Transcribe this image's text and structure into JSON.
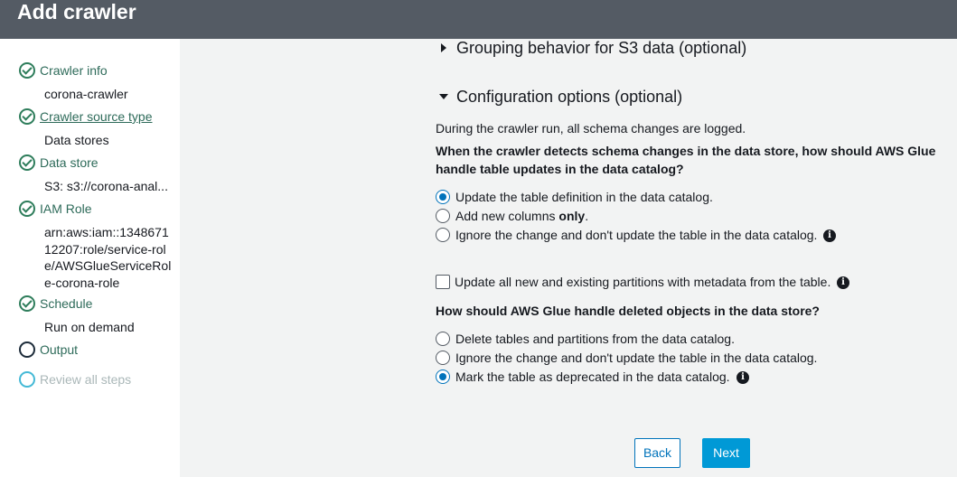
{
  "header": {
    "title": "Add crawler"
  },
  "sidebar": {
    "steps": [
      {
        "label": "Crawler info",
        "value": "corona-crawler"
      },
      {
        "label": "Crawler source type",
        "value": "Data stores"
      },
      {
        "label": "Data store",
        "value": "S3: s3://corona-anal..."
      },
      {
        "label": "IAM Role",
        "value": "arn:aws:iam::134867112207:role/service-role/AWSGlueServiceRole-corona-role"
      },
      {
        "label": "Schedule",
        "value": "Run on demand"
      },
      {
        "label": "Output"
      },
      {
        "label": "Review all steps"
      }
    ]
  },
  "main": {
    "grouping_title": "Grouping behavior for S3 data (optional)",
    "config_title": "Configuration options (optional)",
    "intro": "During the crawler run, all schema changes are logged.",
    "q1": {
      "line1": "When the crawler detects schema changes in the data store, how should AWS Glue",
      "line2": "handle table updates in the data catalog?",
      "options": [
        {
          "label": "Update the table definition in the data catalog.",
          "checked": true
        },
        {
          "label_prefix": "Add new columns ",
          "label_bold": "only",
          "label_suffix": ".",
          "checked": false
        },
        {
          "label": "Ignore the change and don't update the table in the data catalog.",
          "checked": false
        }
      ]
    },
    "partitions_checkbox": {
      "label": "Update all new and existing partitions with metadata from the table.",
      "checked": false
    },
    "q2": {
      "question": "How should AWS Glue handle deleted objects in the data store?",
      "options": [
        {
          "label": "Delete tables and partitions from the data catalog.",
          "checked": false
        },
        {
          "label": "Ignore the change and don't update the table in the data catalog.",
          "checked": false
        },
        {
          "label": "Mark the table as deprecated in the data catalog.",
          "checked": true
        }
      ]
    },
    "info_glyph": "i",
    "back_label": "Back",
    "next_label": "Next"
  },
  "colors": {
    "header_bg": "#545b64",
    "accent": "#0073bb",
    "primary_button": "#0099d6",
    "step_done": "#2e7d5b",
    "step_disabled": "#44b9d6"
  },
  "icons": [
    "check-circle-icon",
    "empty-circle-icon",
    "caret-right-icon",
    "caret-down-icon",
    "info-icon"
  ]
}
